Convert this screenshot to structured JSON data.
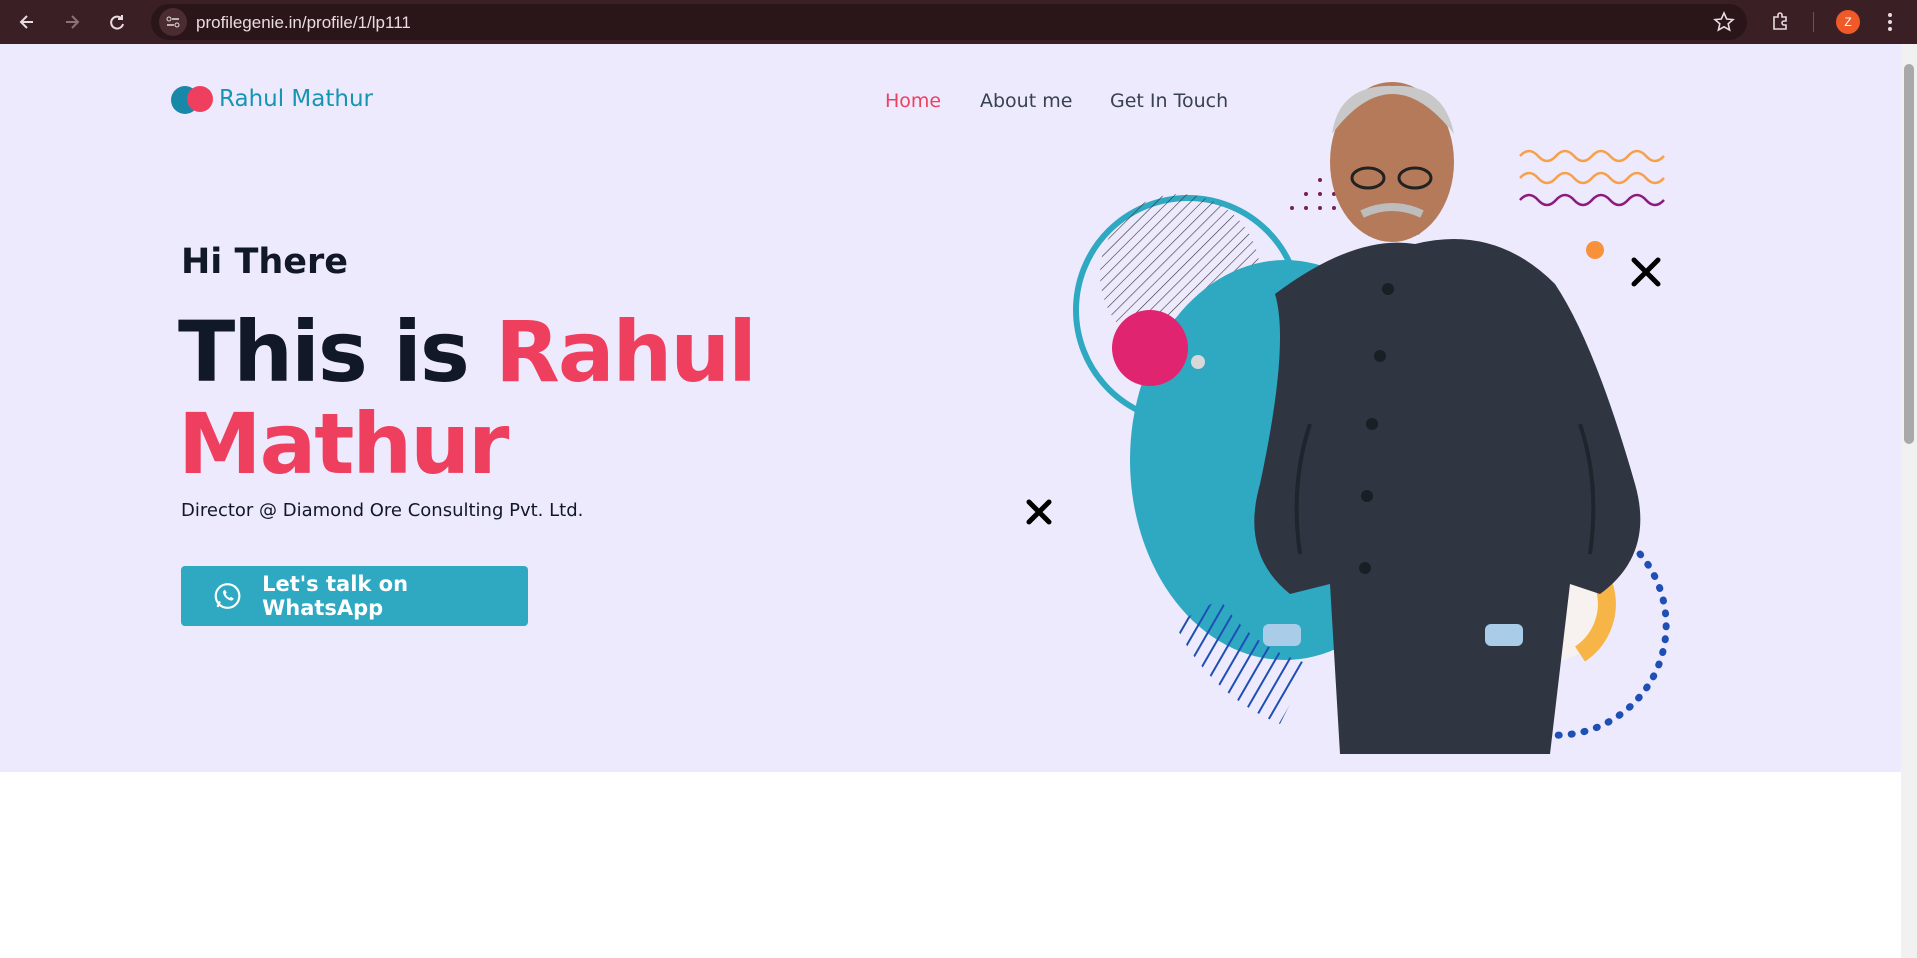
{
  "browser": {
    "url": "profilegenie.in/profile/1/lp111",
    "profile_initial": "Z"
  },
  "site": {
    "brand": "Rahul Mathur",
    "nav": [
      "Home",
      "About me",
      "Get In Touch"
    ]
  },
  "hero": {
    "greeting": "Hi There",
    "headline_prefix": "This is ",
    "headline_name": "Rahul Mathur",
    "role": "Director @ Diamond Ore Consulting Pvt. Ltd.",
    "cta": "Let's talk on WhatsApp"
  },
  "colors": {
    "accent": "#ef3f5e",
    "brand": "#1894b3",
    "cta": "#2fa9c2",
    "hero_bg": "#eeeafd"
  },
  "icons": [
    "back-icon",
    "forward-icon",
    "reload-icon",
    "site-info-icon",
    "star-icon",
    "extensions-icon",
    "menu-icon",
    "whatsapp-icon"
  ]
}
